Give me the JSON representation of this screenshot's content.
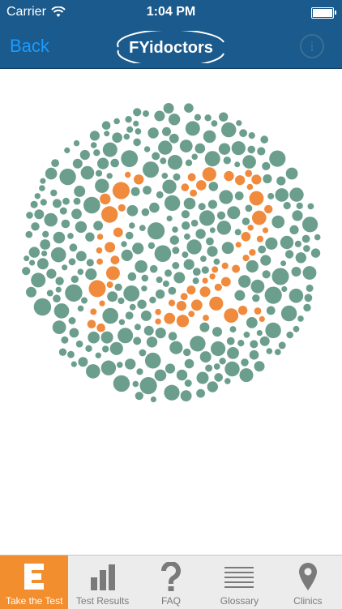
{
  "status_bar": {
    "carrier": "Carrier",
    "time": "1:04 PM"
  },
  "nav_bar": {
    "back_label": "Back",
    "logo_text": "FYidoctors"
  },
  "plate": {
    "background_color": "#6c9e8d",
    "figure_color": "#f08a3c",
    "digits_shown": "12"
  },
  "tabs": [
    {
      "label": "Take the Test",
      "icon": "e-letter-icon",
      "active": true
    },
    {
      "label": "Test Results",
      "icon": "bar-chart-icon",
      "active": false
    },
    {
      "label": "FAQ",
      "icon": "question-mark-icon",
      "active": false
    },
    {
      "label": "Glossary",
      "icon": "list-icon",
      "active": false
    },
    {
      "label": "Clinics",
      "icon": "map-pin-icon",
      "active": false
    }
  ],
  "colors": {
    "nav": "#1b5a8c",
    "accent": "#f38e2f",
    "link": "#1a9bff",
    "tab_gray": "#7a7a7a"
  }
}
